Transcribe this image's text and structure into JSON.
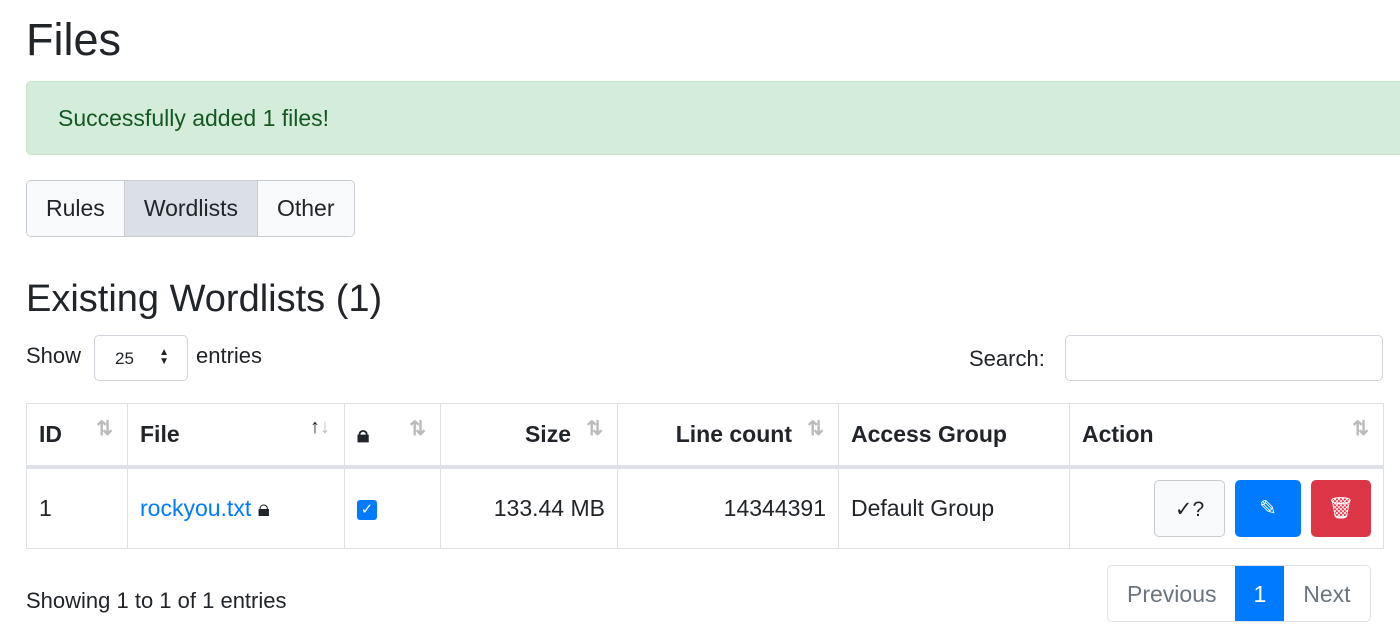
{
  "page": {
    "title": "Files"
  },
  "alert": {
    "message": "Successfully added 1 files!"
  },
  "tabs": [
    {
      "label": "Rules"
    },
    {
      "label": "Wordlists",
      "active": true
    },
    {
      "label": "Other"
    }
  ],
  "section": {
    "title": "Existing Wordlists (1)"
  },
  "length": {
    "show": "Show",
    "value": "25",
    "entries": "entries"
  },
  "search": {
    "label": "Search:",
    "value": ""
  },
  "table": {
    "headers": [
      "ID",
      "File",
      "",
      "Size",
      "Line count",
      "Access Group",
      "Action"
    ],
    "rows": [
      {
        "id": "1",
        "file": "rockyou.txt",
        "secret": true,
        "size": "133.44 MB",
        "lines": "14344391",
        "group": "Default Group",
        "check_label": "✓?"
      }
    ]
  },
  "footer": {
    "status": "Showing 1 to 1 of 1 entries",
    "prev": "Previous",
    "page": "1",
    "next": "Next"
  },
  "colors": {
    "primary": "#007bff",
    "danger": "#dc3545",
    "success_bg": "#d4edda"
  }
}
